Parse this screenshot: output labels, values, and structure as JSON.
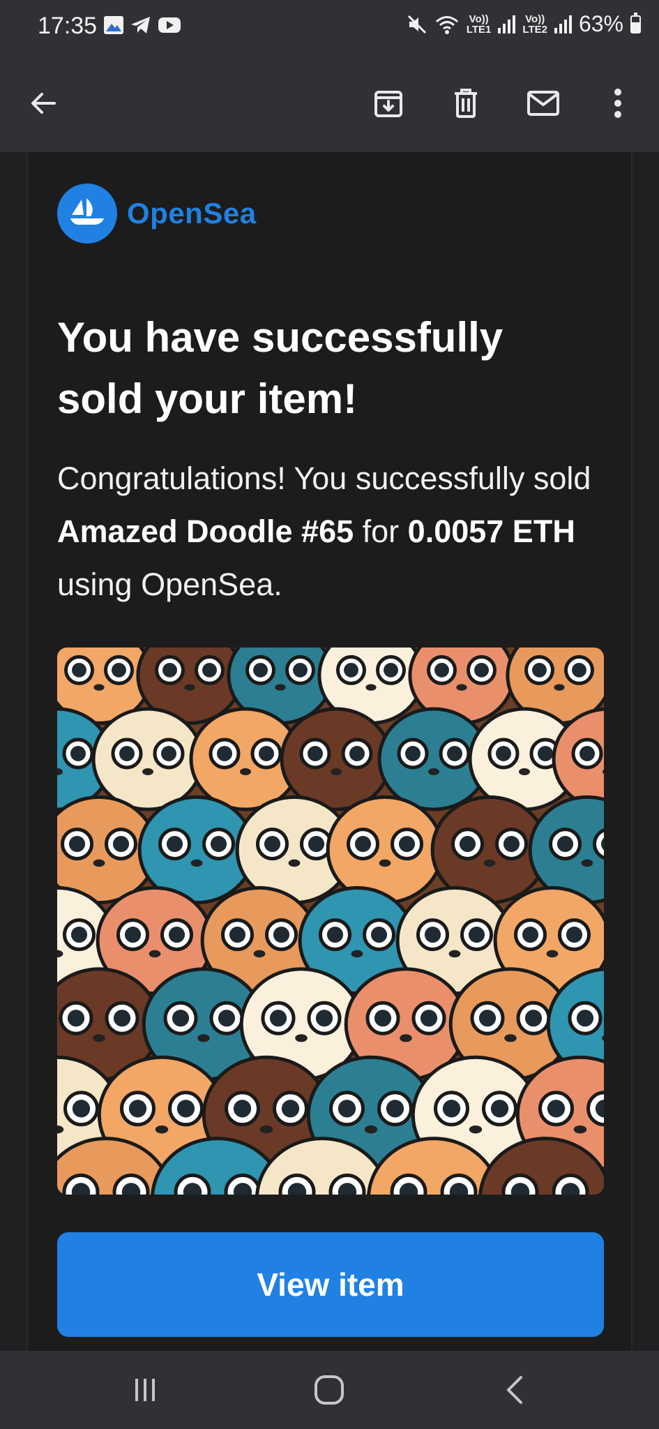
{
  "status": {
    "time": "17:35",
    "app_icons": [
      "gallery-icon",
      "telegram-icon",
      "youtube-icon"
    ],
    "system_icons": [
      "mute-icon",
      "wifi-icon",
      "signal-sim1-icon",
      "signal-sim2-icon",
      "battery-icon"
    ],
    "sim1_label_top": "Vo))",
    "sim1_label_bottom": "LTE1",
    "sim2_label_top": "Vo))",
    "sim2_label_bottom": "LTE2",
    "battery": "63%",
    "battery_level": 0.63
  },
  "toolbar": {
    "icons": [
      "back-arrow-icon",
      "archive-icon",
      "delete-icon",
      "mark-unread-icon",
      "more-options-icon"
    ]
  },
  "email": {
    "brand": "OpenSea",
    "headline": "You have successfully sold your item!",
    "congrats_prefix": "Congratulations! You successfully sold ",
    "item_name": "Amazed Doodle #65",
    "mid_text": " for ",
    "price": "0.0057 ETH",
    "suffix": " using OpenSea.",
    "image_subject": "Amazed Doodle #65 artwork",
    "button_label": "View item",
    "accent_color": "#2081e2"
  },
  "navbar": {
    "icons": [
      "recent-apps-icon",
      "home-icon",
      "back-icon"
    ]
  }
}
